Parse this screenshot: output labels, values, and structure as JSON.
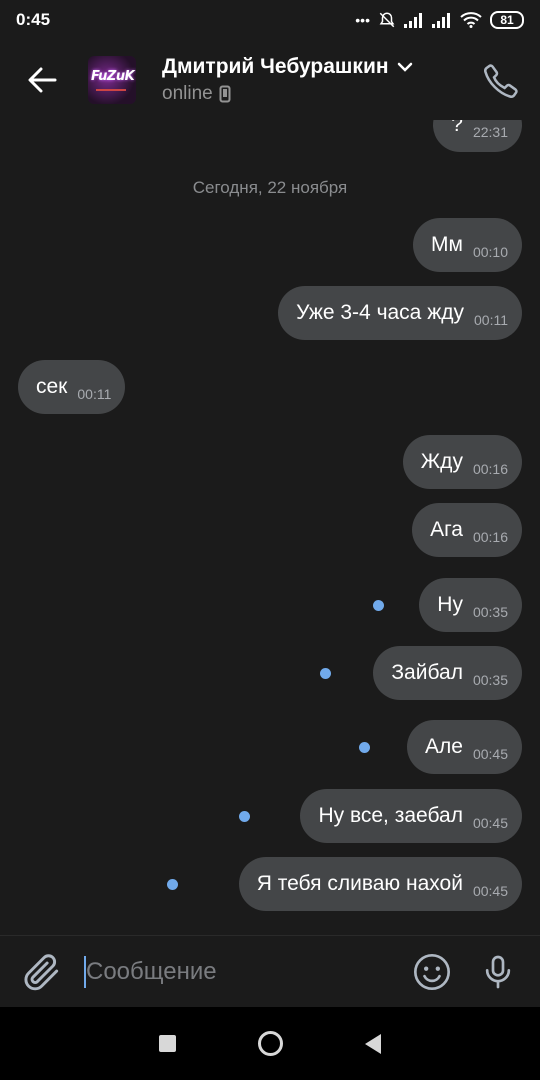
{
  "statusbar": {
    "time": "0:45",
    "battery": "81"
  },
  "header": {
    "title": "Дмитрий Чебурашкин",
    "status": "online",
    "avatar_text": "FuZuK"
  },
  "chat": {
    "date_separator": "Сегодня, 22 ноября",
    "messages": [
      {
        "text": "?",
        "time": "22:31",
        "from": "out",
        "unread": false
      },
      {
        "text": "Мм",
        "time": "00:10",
        "from": "out",
        "unread": false
      },
      {
        "text": "Уже 3-4 часа жду",
        "time": "00:11",
        "from": "out",
        "unread": false
      },
      {
        "text": "сек",
        "time": "00:11",
        "from": "in",
        "unread": false
      },
      {
        "text": "Жду",
        "time": "00:16",
        "from": "out",
        "unread": false
      },
      {
        "text": "Ага",
        "time": "00:16",
        "from": "out",
        "unread": false
      },
      {
        "text": "Ну",
        "time": "00:35",
        "from": "out",
        "unread": true
      },
      {
        "text": "Зайбал",
        "time": "00:35",
        "from": "out",
        "unread": true
      },
      {
        "text": "Але",
        "time": "00:45",
        "from": "out",
        "unread": true
      },
      {
        "text": "Ну все, заебал",
        "time": "00:45",
        "from": "out",
        "unread": true
      },
      {
        "text": "Я тебя сливаю нахой",
        "time": "00:45",
        "from": "out",
        "unread": true
      }
    ]
  },
  "composer": {
    "placeholder": "Сообщение"
  },
  "colors": {
    "bubble": "#444648",
    "background": "#1b1b1b",
    "unread_dot": "#71aaeb",
    "accent": "#71aaeb"
  },
  "icons": [
    "back-arrow-icon",
    "chevron-down-icon",
    "phone-icon",
    "mobile-device-icon",
    "paperclip-icon",
    "smile-icon",
    "microphone-icon",
    "bell-muted-icon",
    "signal-icon",
    "wifi-icon"
  ]
}
